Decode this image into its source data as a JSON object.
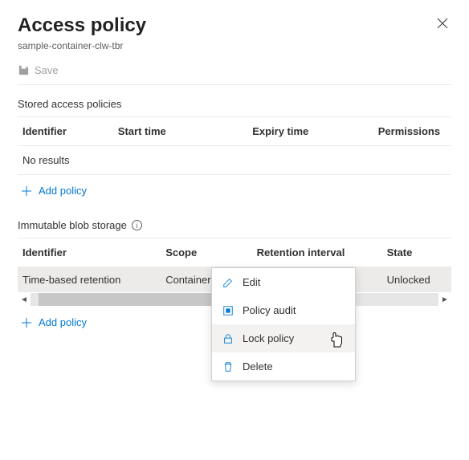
{
  "header": {
    "title": "Access policy",
    "subtitle": "sample-container-clw-tbr"
  },
  "toolbar": {
    "save_label": "Save"
  },
  "stored": {
    "section_label": "Stored access policies",
    "columns": {
      "identifier": "Identifier",
      "start": "Start time",
      "expiry": "Expiry time",
      "permissions": "Permissions"
    },
    "empty_text": "No results",
    "add_label": "Add policy"
  },
  "immutable": {
    "section_label": "Immutable blob storage",
    "columns": {
      "identifier": "Identifier",
      "scope": "Scope",
      "retention": "Retention interval",
      "state": "State"
    },
    "rows": [
      {
        "identifier": "Time-based retention",
        "scope": "Container",
        "retention": "",
        "state": "Unlocked"
      }
    ],
    "add_label": "Add policy"
  },
  "menu": {
    "edit": "Edit",
    "audit": "Policy audit",
    "lock": "Lock policy",
    "delete": "Delete"
  }
}
